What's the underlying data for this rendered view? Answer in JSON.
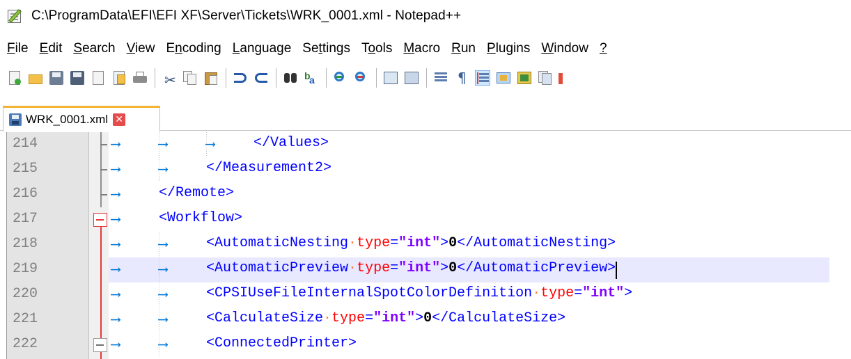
{
  "window": {
    "title": "C:\\ProgramData\\EFI\\EFI XF\\Server\\Tickets\\WRK_0001.xml - Notepad++"
  },
  "menu": [
    {
      "label": "File",
      "underline": "F",
      "rest": "ile"
    },
    {
      "label": "Edit",
      "underline": "E",
      "rest": "dit"
    },
    {
      "label": "Search",
      "underline": "S",
      "rest": "earch"
    },
    {
      "label": "View",
      "underline": "V",
      "rest": "iew"
    },
    {
      "label": "Encoding",
      "pre": "E",
      "underline": "n",
      "rest": "coding"
    },
    {
      "label": "Language",
      "underline": "L",
      "rest": "anguage"
    },
    {
      "label": "Settings",
      "pre": "Se",
      "underline": "t",
      "rest": "tings"
    },
    {
      "label": "Tools",
      "pre": "T",
      "underline": "o",
      "rest": "ols"
    },
    {
      "label": "Macro",
      "underline": "M",
      "rest": "acro"
    },
    {
      "label": "Run",
      "underline": "R",
      "rest": "un"
    },
    {
      "label": "Plugins",
      "underline": "P",
      "rest": "lugins"
    },
    {
      "label": "Window",
      "underline": "W",
      "rest": "indow"
    },
    {
      "label": "?",
      "underline": "?",
      "rest": ""
    }
  ],
  "toolbar": {
    "icons": [
      "new-file-icon",
      "open-file-icon",
      "save-icon",
      "save-all-icon",
      "close-icon",
      "close-all-icon",
      "print-icon",
      "cut-icon",
      "copy-icon",
      "paste-icon",
      "undo-icon",
      "redo-icon",
      "find-icon",
      "replace-icon",
      "zoom-in-icon",
      "zoom-out-icon",
      "sync-vertical-icon",
      "sync-horizontal-icon",
      "word-wrap-icon",
      "show-all-chars-icon",
      "indent-guide-icon",
      "user-language-icon",
      "doc-map-icon",
      "function-list-icon"
    ]
  },
  "tab": {
    "label": "WRK_0001.xml",
    "close_glyph": "✕"
  },
  "editor": {
    "lines": [
      {
        "num": "214",
        "tokens": [
          [
            "tag",
            "</Values>"
          ]
        ],
        "indent": 3
      },
      {
        "num": "215",
        "tokens": [
          [
            "tag",
            "</Measurement2>"
          ]
        ],
        "indent": 2
      },
      {
        "num": "216",
        "tokens": [
          [
            "tag",
            "</Remote>"
          ]
        ],
        "indent": 1
      },
      {
        "num": "217",
        "tokens": [
          [
            "tag",
            "<Workflow>"
          ]
        ],
        "indent": 1
      },
      {
        "num": "218",
        "tokens": [
          [
            "tag",
            "<AutomaticNesting"
          ],
          [
            "dot",
            "·"
          ],
          [
            "attr",
            "type"
          ],
          [
            "tag",
            "="
          ],
          [
            "str",
            "\"int\""
          ],
          [
            "tag",
            ">"
          ],
          [
            "txt",
            "0"
          ],
          [
            "tag",
            "</AutomaticNesting>"
          ]
        ],
        "indent": 2
      },
      {
        "num": "219",
        "tokens": [
          [
            "tag",
            "<AutomaticPreview"
          ],
          [
            "dot",
            "·"
          ],
          [
            "attr",
            "type"
          ],
          [
            "tag",
            "="
          ],
          [
            "str",
            "\"int\""
          ],
          [
            "tag",
            ">"
          ],
          [
            "txt",
            "0"
          ],
          [
            "tag",
            "</AutomaticPreview>"
          ]
        ],
        "indent": 2
      },
      {
        "num": "220",
        "tokens": [
          [
            "tag",
            "<CPSIUseFileInternalSpotColorDefinition"
          ],
          [
            "dot",
            "·"
          ],
          [
            "attr",
            "type"
          ],
          [
            "tag",
            "="
          ],
          [
            "str",
            "\"int\""
          ],
          [
            "tag",
            ">"
          ]
        ],
        "indent": 2
      },
      {
        "num": "221",
        "tokens": [
          [
            "tag",
            "<CalculateSize"
          ],
          [
            "dot",
            "·"
          ],
          [
            "attr",
            "type"
          ],
          [
            "tag",
            "="
          ],
          [
            "str",
            "\"int\""
          ],
          [
            "tag",
            ">"
          ],
          [
            "txt",
            "0"
          ],
          [
            "tag",
            "</CalculateSize>"
          ]
        ],
        "indent": 2
      },
      {
        "num": "222",
        "tokens": [
          [
            "tag",
            "<ConnectedPrinter>"
          ]
        ],
        "indent": 2
      }
    ],
    "arrow_glyph": "⟶",
    "current_line": "219"
  },
  "colors": {
    "tag": "#0000ff",
    "attr": "#ff0000",
    "string": "#8000ff",
    "line_highlight": "#e8e8ff",
    "fold_marker": "#e23b3b",
    "tab_accent": "#f4b335"
  }
}
